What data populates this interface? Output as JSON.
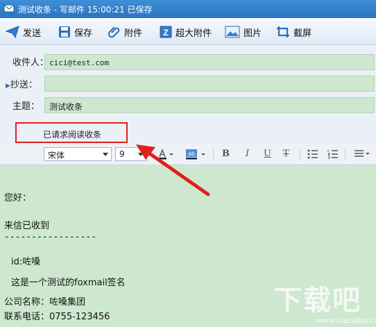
{
  "window": {
    "title": "测试收条 - 写邮件   15:00:21 已保存"
  },
  "toolbar": {
    "send": "发送",
    "save": "保存",
    "attach": "附件",
    "big_attach": "超大附件",
    "image": "图片",
    "screenshot": "截屏"
  },
  "header": {
    "to_label": "收件人：",
    "to_value": "cici@test.com",
    "cc_label": "抄送：",
    "cc_value": "",
    "subject_label": "主题：",
    "subject_value": "测试收条",
    "receipt_text": "已请求阅读收条"
  },
  "format": {
    "font": "宋体",
    "size": "9",
    "bold": "B",
    "italic": "I",
    "underline": "U",
    "strike": "T"
  },
  "body": {
    "lines": [
      "您好：",
      "来信已收到",
      "-----------------",
      "id:咗嗓",
      "这是一个测试的foxmail签名",
      "公司名称：咗嗓集团",
      "联系电话：0755-123456"
    ]
  },
  "watermark": {
    "text": "下载吧",
    "url": "www.xiazaiba.com"
  },
  "colors": {
    "titlebar": "#2a73c0",
    "field_bg": "#cde8cf",
    "highlight": "#e0201c"
  }
}
